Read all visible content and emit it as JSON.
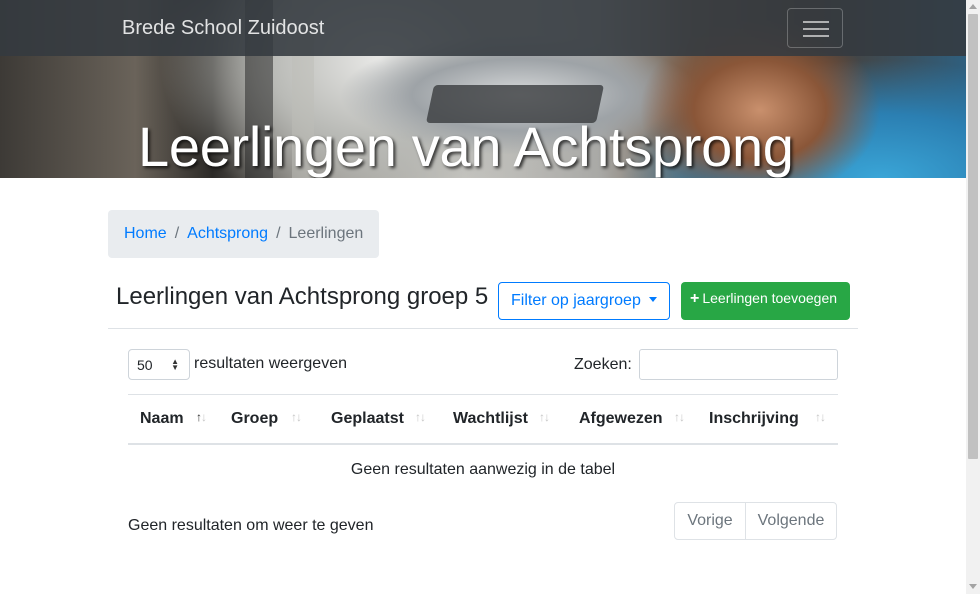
{
  "navbar": {
    "brand": "Brede School Zuidoost",
    "toggler_icon": "hamburger-icon"
  },
  "hero": {
    "title": "Leerlingen van Achtsprong"
  },
  "breadcrumb": {
    "items": [
      "Home",
      "Achtsprong"
    ],
    "active": "Leerlingen",
    "separator": "/"
  },
  "header": {
    "title": "Leerlingen van Achtsprong groep 5",
    "filter_button": "Filter op jaargroep",
    "add_button": "Leerlingen toevoegen",
    "add_icon": "plus-icon"
  },
  "table_controls": {
    "length_value": "50",
    "length_label": "resultaten weergeven",
    "search_label": "Zoeken:",
    "search_value": ""
  },
  "table": {
    "columns": [
      "Naam",
      "Groep",
      "Geplaatst",
      "Wachtlijst",
      "Afgewezen",
      "Inschrijving"
    ],
    "sort_glyph_up": "↑",
    "sort_glyph_down": "↓",
    "sorted_column": "Naam",
    "empty_message": "Geen resultaten aanwezig in de tabel"
  },
  "footer": {
    "info": "Geen resultaten om weer te geven",
    "prev": "Vorige",
    "next": "Volgende"
  },
  "colors": {
    "primary": "#007bff",
    "success": "#28a745",
    "navbar": "#343a40"
  }
}
